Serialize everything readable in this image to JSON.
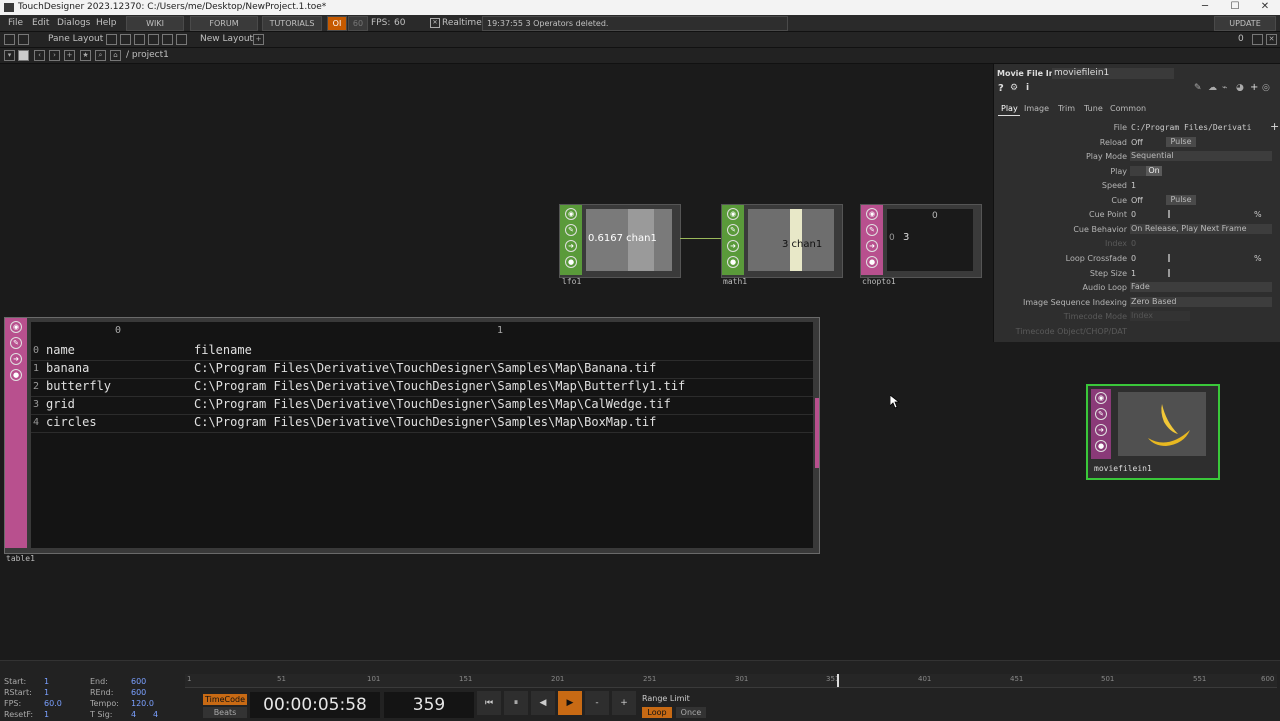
{
  "window": {
    "title": "TouchDesigner 2023.12370: C:/Users/me/Desktop/NewProject.1.toe*",
    "min": "─",
    "max": "☐",
    "close": "✕"
  },
  "menu": {
    "items": [
      "File",
      "Edit",
      "Dialogs",
      "Help"
    ],
    "wiki": "WIKI",
    "forum": "FORUM",
    "tutorials": "TUTORIALS",
    "oi": "OI",
    "fps_set": "60",
    "fps_label": "FPS:",
    "fps_value": "60",
    "realtime": "Realtime",
    "status": "19:37:55 3 Operators deleted.",
    "update": "UPDATE"
  },
  "panebar": {
    "pane_layout": "Pane Layout",
    "new_layout": "New Layout",
    "count": "0"
  },
  "pathbar": {
    "path": "/ project1"
  },
  "nodes": {
    "lfo": {
      "name": "lfo1",
      "value": "0.6167 chan1"
    },
    "math": {
      "name": "math1",
      "value": "3 chan1"
    },
    "chopto": {
      "name": "chopto1",
      "col": "0",
      "row_idx": "0",
      "row_val": "3"
    },
    "movie": {
      "name": "moviefilein1"
    }
  },
  "table": {
    "name": "table1",
    "col_headers": [
      "0",
      "1"
    ],
    "rows": [
      {
        "i": "0",
        "a": "name",
        "b": "filename"
      },
      {
        "i": "1",
        "a": "banana",
        "b": "C:\\Program Files\\Derivative\\TouchDesigner\\Samples\\Map\\Banana.tif"
      },
      {
        "i": "2",
        "a": "butterfly",
        "b": "C:\\Program Files\\Derivative\\TouchDesigner\\Samples\\Map\\Butterfly1.tif"
      },
      {
        "i": "3",
        "a": "grid",
        "b": "C:\\Program Files\\Derivative\\TouchDesigner\\Samples\\Map\\CalWedge.tif"
      },
      {
        "i": "4",
        "a": "circles",
        "b": "C:\\Program Files\\Derivative\\TouchDesigner\\Samples\\Map\\BoxMap.tif"
      }
    ]
  },
  "params": {
    "op_type": "Movie File In",
    "op_name": "moviefilein1",
    "tabs": [
      "Play",
      "Image",
      "Trim",
      "Tune",
      "Common"
    ],
    "file_label": "File",
    "file_value": "C:/Program Files/Derivati",
    "reload_label": "Reload",
    "reload_value": "Off",
    "reload_pulse": "Pulse",
    "playmode_label": "Play Mode",
    "playmode_value": "Sequential",
    "play_label": "Play",
    "play_value": "On",
    "speed_label": "Speed",
    "speed_value": "1",
    "cue_label": "Cue",
    "cue_value": "Off",
    "cue_pulse": "Pulse",
    "cuepoint_label": "Cue Point",
    "cuepoint_value": "0",
    "cuepoint_unit": "%",
    "cuebehavior_label": "Cue Behavior",
    "cuebehavior_value": "On Release, Play Next Frame",
    "index_label": "Index",
    "index_value": "0",
    "loopcrossfade_label": "Loop Crossfade",
    "loopcrossfade_value": "0",
    "loopcrossfade_unit": "%",
    "stepsize_label": "Step Size",
    "stepsize_value": "1",
    "audioloop_label": "Audio Loop",
    "audioloop_value": "Fade",
    "imgseq_label": "Image Sequence Indexing",
    "imgseq_value": "Zero Based",
    "timecodemode_label": "Timecode Mode",
    "timecodemode_value": "Index",
    "timecodeobj_label": "Timecode Object/CHOP/DAT"
  },
  "timeline": {
    "start_label": "Start:",
    "start": "1",
    "end_label": "End:",
    "end": "600",
    "rstart_label": "RStart:",
    "rstart": "1",
    "rend_label": "REnd:",
    "rend": "600",
    "fps_label": "FPS:",
    "fps": "60.0",
    "tempo_label": "Tempo:",
    "tempo": "120.0",
    "resetf_label": "ResetF:",
    "resetf": "1",
    "tsig_label": "T Sig:",
    "tsig_a": "4",
    "tsig_b": "4",
    "ticks": [
      "1",
      "51",
      "101",
      "151",
      "201",
      "251",
      "301",
      "351",
      "401",
      "451",
      "501",
      "551",
      "600"
    ],
    "timecode_btn": "TimeCode",
    "beats_btn": "Beats",
    "timecode": "00:00:05:58",
    "frame": "359",
    "range_limit": "Range Limit",
    "loop": "Loop",
    "once": "Once",
    "ctrl_first": "⏮",
    "ctrl_pause": "⏸",
    "ctrl_back": "◀",
    "ctrl_play": "▶",
    "ctrl_minus": "-",
    "ctrl_plus": "+"
  }
}
